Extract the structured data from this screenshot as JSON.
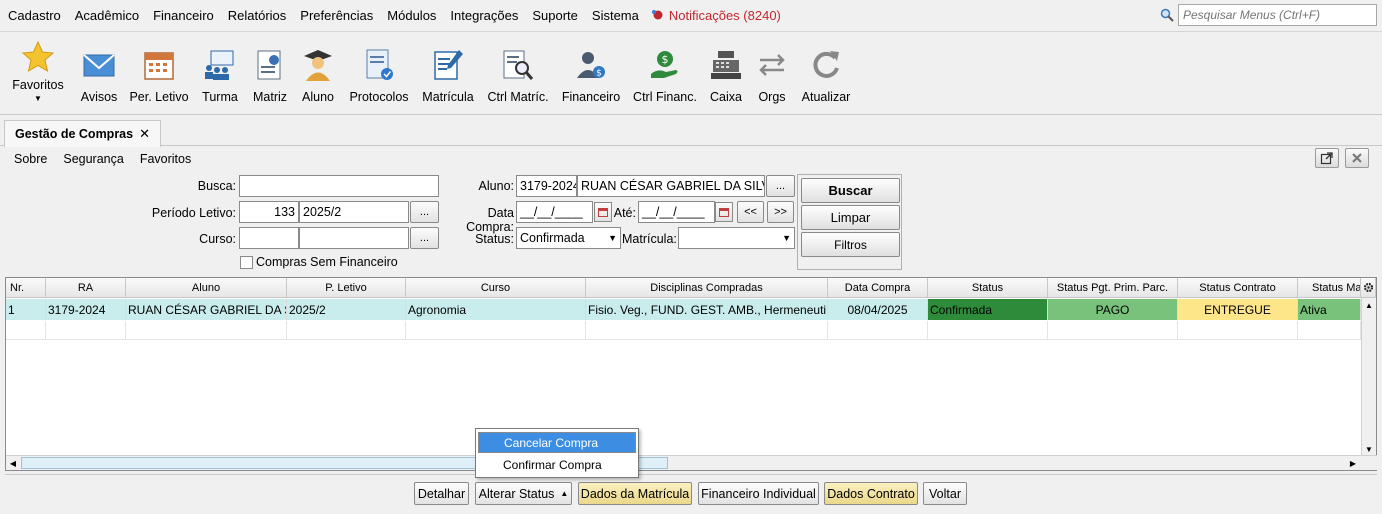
{
  "menu": {
    "items": [
      "Cadastro",
      "Acadêmico",
      "Financeiro",
      "Relatórios",
      "Preferências",
      "Módulos",
      "Integrações",
      "Suporte",
      "Sistema"
    ],
    "notifications": "Notificações (8240)",
    "search_placeholder": "Pesquisar Menus (Ctrl+F)"
  },
  "toolbar": {
    "favoritos": "Favoritos",
    "avisos": "Avisos",
    "per_letivo": "Per. Letivo",
    "turma": "Turma",
    "matriz": "Matriz",
    "aluno": "Aluno",
    "protocolos": "Protocolos",
    "matricula": "Matrícula",
    "ctrl_matric": "Ctrl Matríc.",
    "financeiro": "Financeiro",
    "ctrl_financ": "Ctrl Financ.",
    "caixa": "Caixa",
    "orgs": "Orgs",
    "atualizar": "Atualizar"
  },
  "tab": {
    "title": "Gestão de Compras",
    "close": "✕"
  },
  "submenu": {
    "sobre": "Sobre",
    "seguranca": "Segurança",
    "favoritos": "Favoritos"
  },
  "filters": {
    "busca_label": "Busca:",
    "busca_value": "",
    "periodo_label": "Período Letivo:",
    "periodo_code": "133",
    "periodo_name": "2025/2",
    "curso_label": "Curso:",
    "aluno_label": "Aluno:",
    "aluno_ra": "3179-2024",
    "aluno_name": "RUAN CÉSAR GABRIEL DA SILVA",
    "data_compra_label": "Data Compra:",
    "data_from": "__/__/____",
    "ate_label": "Até:",
    "data_to": "__/__/____",
    "status_label": "Status:",
    "status_value": "Confirmada",
    "matricula_label": "Matrícula:",
    "matricula_value": "",
    "sem_financeiro": "Compras Sem Financeiro",
    "ellipsis": "...",
    "prev": "<<",
    "next": ">>",
    "buscar": "Buscar",
    "limpar": "Limpar",
    "filtros": "Filtros"
  },
  "grid": {
    "headers": [
      "Nr.",
      "RA",
      "Aluno",
      "P. Letivo",
      "Curso",
      "Disciplinas Compradas",
      "Data Compra",
      "Status",
      "Status Pgt. Prim. Parc.",
      "Status Contrato",
      "Status Ma"
    ],
    "rows": [
      [
        "1",
        "3179-2024",
        "RUAN CÉSAR GABRIEL DA S...",
        "2025/2",
        "Agronomia",
        "Fisio. Veg., FUND. GEST.  AMB., Hermeneuti...",
        "08/04/2025",
        "Confirmada",
        "PAGO",
        "ENTREGUE",
        "Ativa"
      ]
    ],
    "colors": {
      "selected_row": "#c9ecec",
      "confirmada": "#2e8b3a",
      "pago": "#79c27c",
      "entregue": "#fde58a",
      "ativa": "#79c27c"
    }
  },
  "context_menu": {
    "items": [
      "Cancelar Compra",
      "Confirmar Compra"
    ]
  },
  "bottom": {
    "detalhar": "Detalhar",
    "alterar_status": "Alterar Status",
    "dados_matricula": "Dados da Matrícula",
    "financeiro_individual": "Financeiro Individual",
    "dados_contrato": "Dados Contrato",
    "voltar": "Voltar"
  }
}
